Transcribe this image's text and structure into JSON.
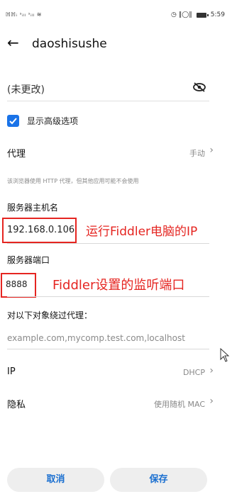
{
  "status": {
    "left_text": "ℍℍᵢ ˢᵢₗₗ ˢᵢₗₗ ≋",
    "right_icons": "◷ ‖◯‖",
    "time": "5:59"
  },
  "header": {
    "back_symbol": "←",
    "title": "daoshisushe"
  },
  "password": {
    "value": "(未更改)",
    "icon": "eye-off-icon"
  },
  "advanced": {
    "checked": true,
    "label": "显示高级选项"
  },
  "proxy": {
    "label": "代理",
    "value": "手动",
    "chevron": "›",
    "hint": "该浏览器使用 HTTP 代理，但其他应用可能不会使用"
  },
  "hostname": {
    "label": "服务器主机名",
    "value": "192.168.0.106",
    "annotation": "运行Fiddler电脑的IP"
  },
  "port": {
    "label": "服务器端口",
    "value": "8888",
    "annotation": "Fiddler设置的监听端口"
  },
  "bypass": {
    "label": "对以下对象绕过代理：",
    "value": "example.com,mycomp.test.com,localhost"
  },
  "ip": {
    "label": "IP",
    "value": "DHCP",
    "chevron": "›"
  },
  "privacy": {
    "label": "隐私",
    "value": "使用随机 MAC",
    "chevron": "›"
  },
  "buttons": {
    "cancel": "取消",
    "save": "保存"
  },
  "colors": {
    "accent": "#1a73e8",
    "annotation_red": "#e52521"
  }
}
